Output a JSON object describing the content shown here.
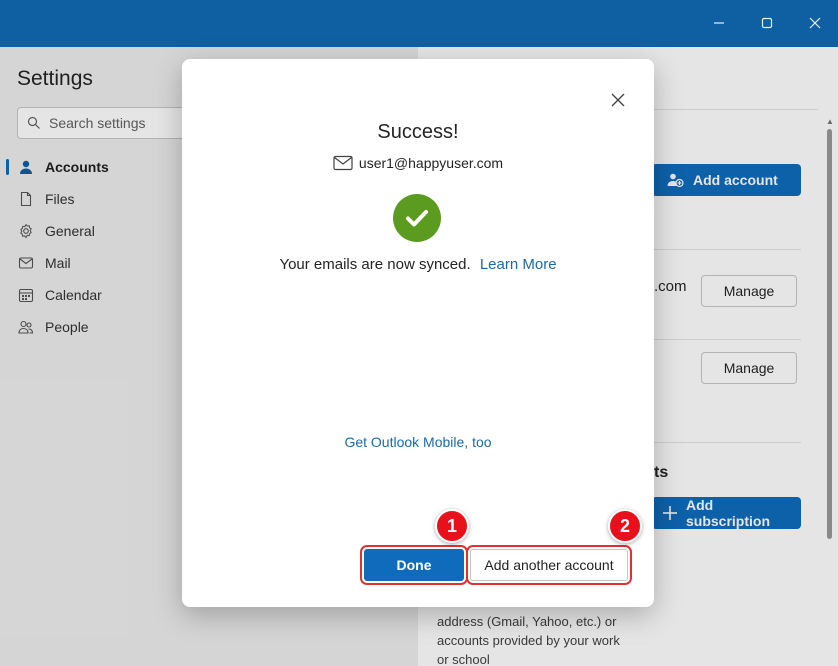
{
  "window": {
    "controls": [
      "minimize-icon",
      "maximize-icon",
      "close-icon"
    ]
  },
  "sidebar": {
    "title": "Settings",
    "search_placeholder": "Search settings",
    "items": [
      {
        "label": "Accounts",
        "icon": "person-icon",
        "active": true
      },
      {
        "label": "Files",
        "icon": "file-icon",
        "active": false
      },
      {
        "label": "General",
        "icon": "gear-icon",
        "active": false
      },
      {
        "label": "Mail",
        "icon": "mail-icon",
        "active": false
      },
      {
        "label": "Calendar",
        "icon": "calendar-icon",
        "active": false
      },
      {
        "label": "People",
        "icon": "people-icon",
        "active": false
      }
    ]
  },
  "content": {
    "add_account_label": "Add account",
    "row1_suffix": ".com",
    "manage_label_1": "Manage",
    "manage_label_2": "Manage",
    "section_fragment": "ts",
    "add_subscription_label": "Add subscription",
    "description": "address (Gmail, Yahoo, etc.) or accounts provided by your work or school"
  },
  "dialog": {
    "title": "Success!",
    "email": "user1@happyuser.com",
    "synced_text": "Your emails are now synced.",
    "learn_more": "Learn More",
    "mobile_link": "Get Outlook Mobile, too",
    "done_label": "Done",
    "add_another_label": "Add another account"
  },
  "callouts": {
    "badge1": "1",
    "badge2": "2"
  },
  "colors": {
    "titlebar": "#0f5fa3",
    "accent": "#0f6cbd",
    "success_green": "#5b9b1f",
    "callout_red": "#e8101a"
  }
}
